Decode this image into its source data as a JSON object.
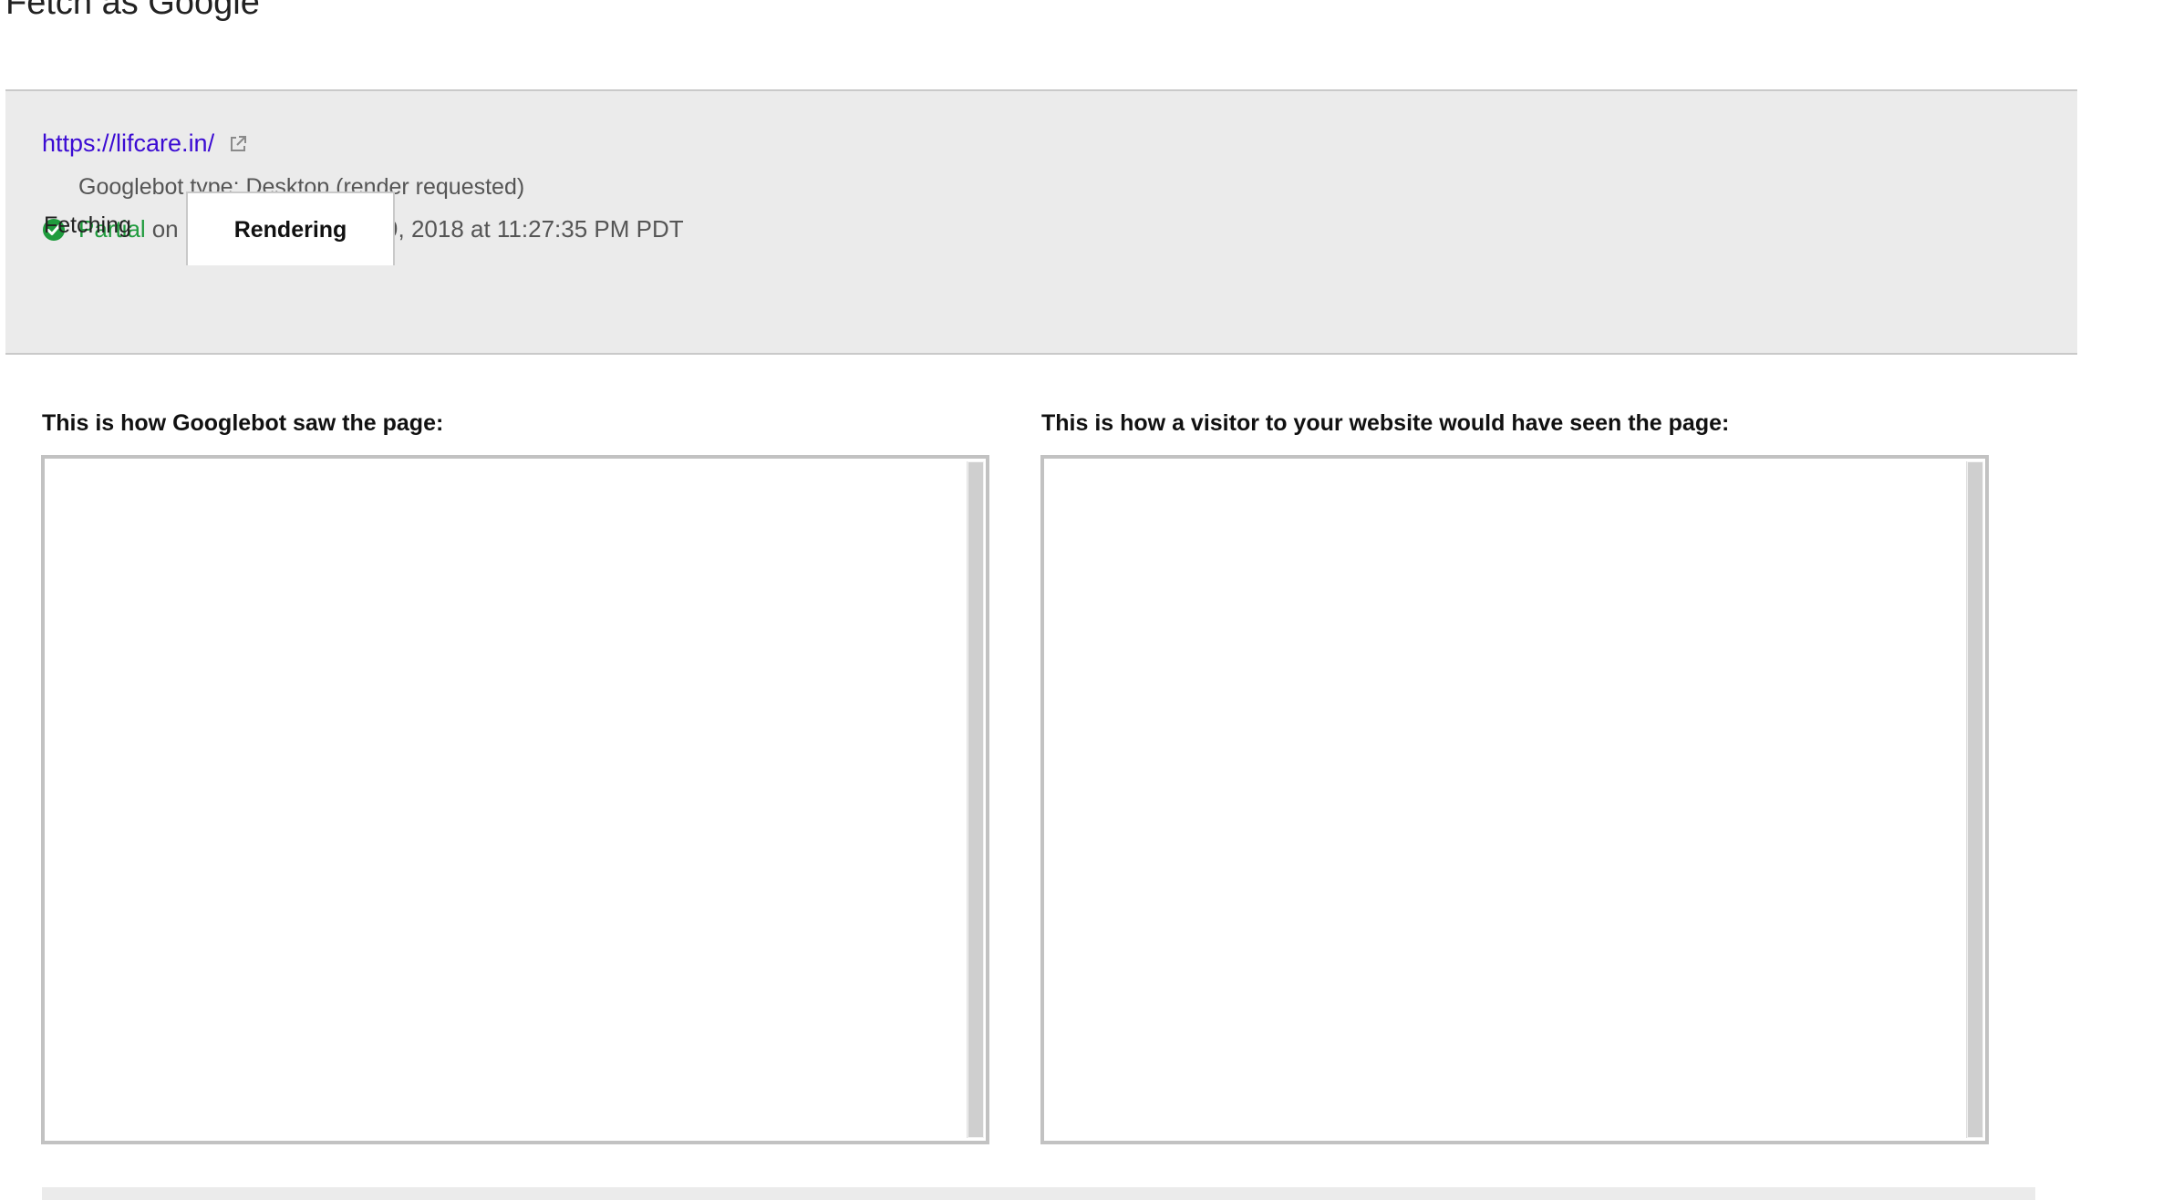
{
  "page": {
    "title": "Fetch as Google"
  },
  "result": {
    "url": "https://lifcare.in/",
    "googlebot_type": "Googlebot type: Desktop (render requested)",
    "status": "Partial",
    "status_date": "on Monday, October 29, 2018 at 11:27:35 PM PDT",
    "status_color": "#1f9b3d",
    "link_color": "#3b0bd3"
  },
  "tabs": [
    {
      "label": "Fetching",
      "selected": false
    },
    {
      "label": "Rendering",
      "selected": true
    }
  ],
  "rendering": {
    "googlebot_caption": "This is how Googlebot saw the page:",
    "visitor_caption": "This is how a visitor to your website would have seen the page:"
  },
  "icons": {
    "external_link": "external-link-icon",
    "status": "check-circle-icon"
  }
}
